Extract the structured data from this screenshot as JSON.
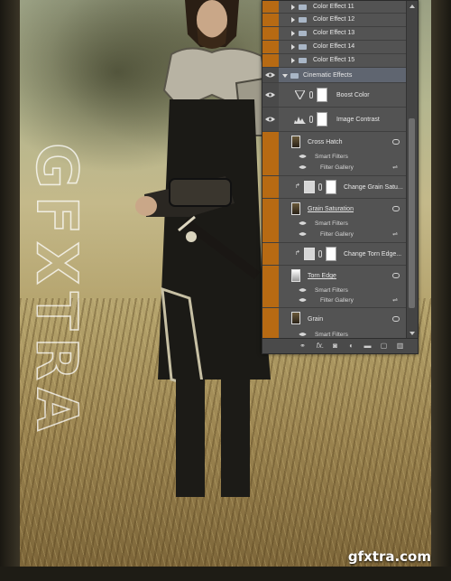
{
  "layers_panel": {
    "color_effects": [
      {
        "name": "Color Effect 11"
      },
      {
        "name": "Color Effect 12"
      },
      {
        "name": "Color Effect 13"
      },
      {
        "name": "Color Effect 14"
      },
      {
        "name": "Color Effect 15"
      }
    ],
    "group": {
      "name": "Cinematic Effects"
    },
    "adjustments": [
      {
        "name": "Boost Color"
      },
      {
        "name": "Image Contrast"
      }
    ],
    "layers": [
      {
        "name": "Cross Hatch",
        "smart_filters": "Smart Filters",
        "filter": "Filter Gallery"
      },
      {
        "name": "Change Grain Satu..."
      },
      {
        "name": "Grain Saturation",
        "smart_filters": "Smart Filters",
        "filter": "Filter Gallery"
      },
      {
        "name": "Change Torn Edge..."
      },
      {
        "name": "Torn Edge",
        "smart_filters": "Smart Filters",
        "filter": "Filter Gallery"
      },
      {
        "name": "Grain",
        "smart_filters": "Smart Filters"
      }
    ],
    "bottom_toolbar": {
      "fx_label": "fx."
    }
  },
  "watermark": {
    "side_text": "GFXTRA",
    "corner_text": "gfxtra.com"
  },
  "colors": {
    "visibility_active": "#b76a13",
    "panel_bg": "#535353"
  }
}
